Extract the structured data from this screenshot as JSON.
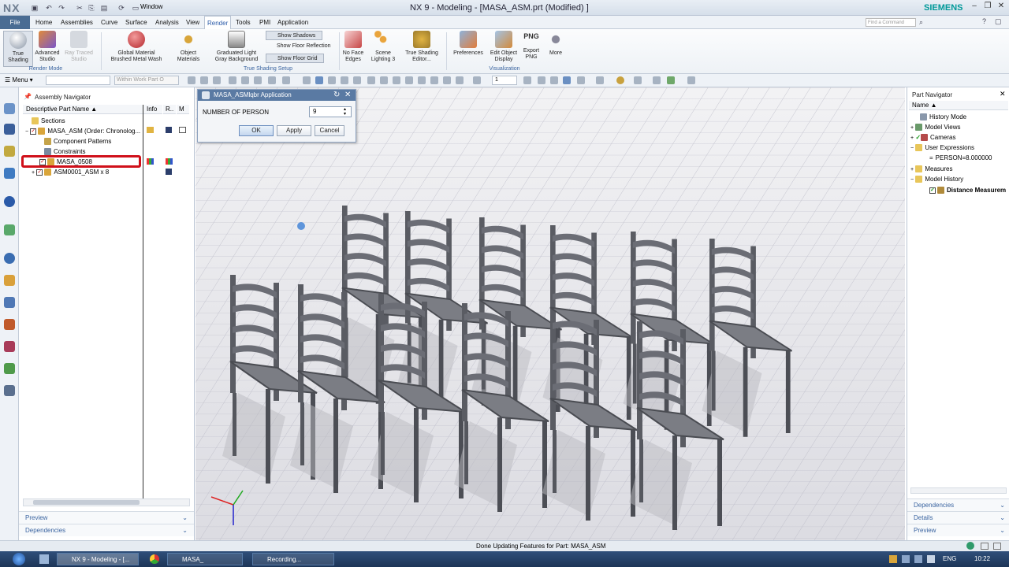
{
  "app": {
    "logo": "NX",
    "window_menu": "Window",
    "title": "NX 9 - Modeling - [MASA_ASM.prt (Modified) ]",
    "brand": "SIEMENS",
    "search_placeholder": "Find a Command"
  },
  "menubar": {
    "file": "File",
    "items": [
      "Home",
      "Assemblies",
      "Curve",
      "Surface",
      "Analysis",
      "View",
      "Render",
      "Tools",
      "PMI",
      "Application"
    ],
    "active": "Render"
  },
  "ribbon": {
    "true_shading": "True Shading",
    "advanced_studio": "Advanced Studio",
    "ray_traced_studio": "Ray Traced Studio",
    "global_material": "Global Material",
    "global_material_value": "Brushed Metal Wash",
    "object_materials": "Object Materials",
    "graduated_light": "Graduated Light",
    "gray_background": "Gray Background",
    "show_shadows": "Show Shadows",
    "show_floor_reflection": "Show Floor Reflection",
    "show_floor_grid": "Show Floor Grid",
    "no_face_edges": "No Face Edges",
    "scene_lighting": "Scene Lighting 3",
    "true_shading_editor": "True Shading Editor...",
    "preferences": "Preferences",
    "edit_object_display": "Edit Object Display",
    "export_png": "Export PNG",
    "png": "PNG",
    "more": "More",
    "group_render_mode": "Render Mode",
    "group_true_shading_setup": "True Shading Setup",
    "group_visualization": "Visualization"
  },
  "toolbar2": {
    "menu": "Menu",
    "selection_scope": "Within Work Part O",
    "layer_value": "1"
  },
  "assembly_navigator": {
    "title": "Assembly Navigator",
    "columns": {
      "name": "Descriptive Part Name",
      "info": "Info",
      "r": "R..",
      "m": "M"
    },
    "rows": [
      "Sections",
      "MASA_ASM (Order: Chronolog...",
      "Component Patterns",
      "Constraints",
      "MASA_0508",
      "ASM0001_ASM x 8"
    ],
    "preview": "Preview",
    "dependencies": "Dependencies"
  },
  "dialog": {
    "title": "MASA_ASMlqbr Application",
    "field_label": "NUMBER OF PERSON",
    "field_value": "9",
    "ok": "OK",
    "apply": "Apply",
    "cancel": "Cancel"
  },
  "part_navigator": {
    "title": "Part Navigator",
    "column": "Name",
    "rows": [
      "History Mode",
      "Model Views",
      "Cameras",
      "User Expressions",
      "PERSON=8.000000",
      "Measures",
      "Model History",
      "Distance Measurem"
    ],
    "dependencies": "Dependencies",
    "details": "Details",
    "preview": "Preview"
  },
  "status": {
    "message": "Done Updating Features for Part: MASA_ASM"
  },
  "taskbar": {
    "items": [
      "NX 9 - Modeling - [...",
      "MASA_",
      "Recording..."
    ],
    "lang": "ENG",
    "time": "10:22"
  },
  "colors": {
    "highlight_red": "#d0101a",
    "title_blue": "#5a7aa3",
    "brand": "#009999"
  }
}
